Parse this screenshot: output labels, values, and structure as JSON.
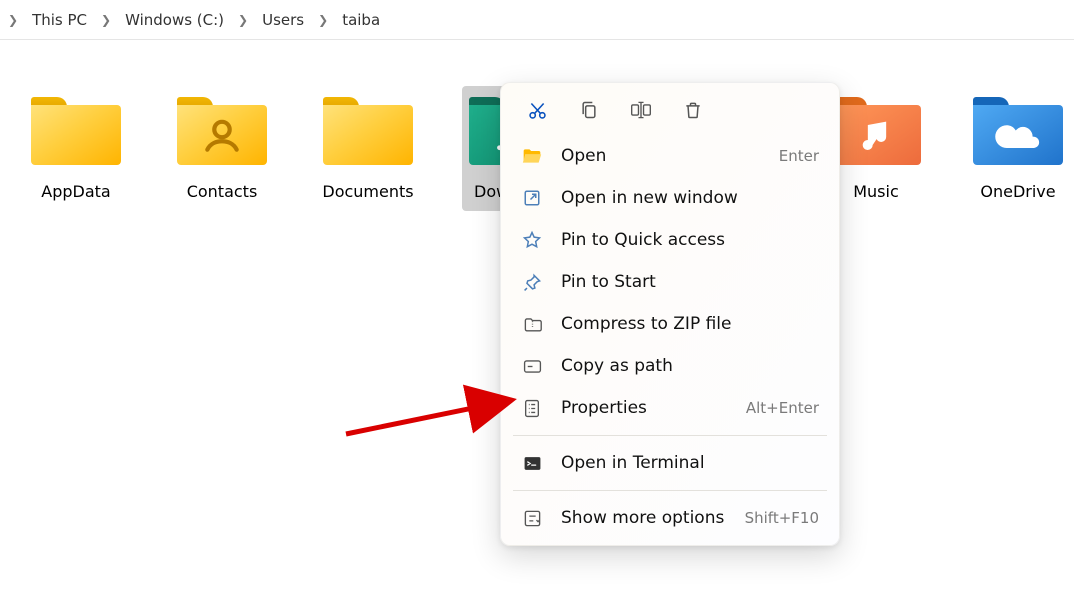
{
  "breadcrumb": {
    "parts": [
      "This PC",
      "Windows (C:)",
      "Users",
      "taiba"
    ]
  },
  "folders": [
    {
      "name": "AppData",
      "style": "yellow",
      "glyph": "none",
      "selected": false
    },
    {
      "name": "Contacts",
      "style": "yellow",
      "glyph": "contact",
      "selected": false
    },
    {
      "name": "Documents",
      "style": "yellow",
      "glyph": "none",
      "selected": false
    },
    {
      "name": "Downloads",
      "style": "green",
      "glyph": "download",
      "selected": true
    },
    {
      "name": "Music",
      "style": "orange",
      "glyph": "music",
      "selected": false
    },
    {
      "name": "OneDrive",
      "style": "blue",
      "glyph": "cloud",
      "selected": false
    }
  ],
  "context_top_icons": [
    "cut",
    "copy",
    "rename",
    "delete"
  ],
  "context_menu": [
    {
      "icon": "open",
      "label": "Open",
      "shortcut": "Enter"
    },
    {
      "icon": "window",
      "label": "Open in new window",
      "shortcut": ""
    },
    {
      "icon": "star",
      "label": "Pin to Quick access",
      "shortcut": ""
    },
    {
      "icon": "pin",
      "label": "Pin to Start",
      "shortcut": ""
    },
    {
      "icon": "zip",
      "label": "Compress to ZIP file",
      "shortcut": ""
    },
    {
      "icon": "path",
      "label": "Copy as path",
      "shortcut": ""
    },
    {
      "icon": "props",
      "label": "Properties",
      "shortcut": "Alt+Enter"
    },
    {
      "sep": true
    },
    {
      "icon": "term",
      "label": "Open in Terminal",
      "shortcut": ""
    },
    {
      "sep": true
    },
    {
      "icon": "more",
      "label": "Show more options",
      "shortcut": "Shift+F10"
    }
  ]
}
